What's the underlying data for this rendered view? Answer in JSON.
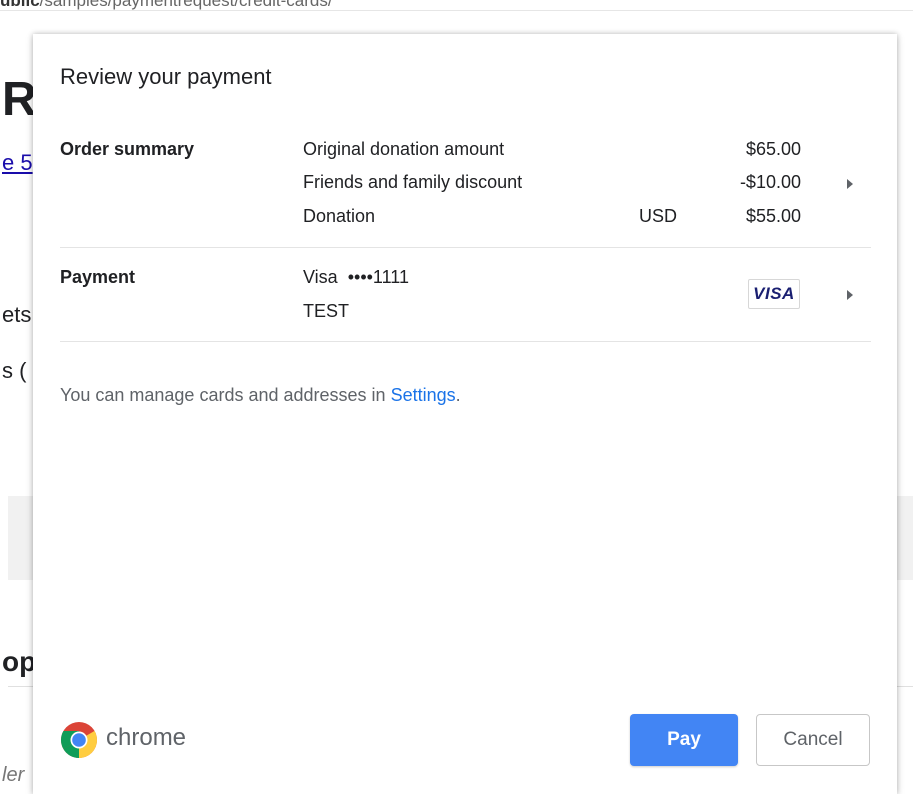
{
  "background_page": {
    "url_bold": "ublic",
    "url_rest": "/samples/paymentrequest/credit-cards/",
    "heading_fragment": "R",
    "link_fragment": "e 5",
    "text_fragment_1": "ets",
    "text_fragment_2": "s (",
    "heading_fragment_2": "op",
    "footer_fragment": "ler"
  },
  "sheet": {
    "title": "Review your payment",
    "order_summary": {
      "label": "Order summary",
      "items": [
        {
          "label": "Original donation amount",
          "currency": "",
          "amount": "$65.00"
        },
        {
          "label": "Friends and family discount",
          "currency": "",
          "amount": "-$10.00"
        },
        {
          "label": "Donation",
          "currency": "USD",
          "amount": "$55.00"
        }
      ]
    },
    "payment": {
      "label": "Payment",
      "card_brand": "Visa",
      "card_mask": "••••1111",
      "cardholder": "TEST",
      "badge": "VISA"
    },
    "manage_text": "You can manage cards and addresses in ",
    "settings_link": "Settings",
    "manage_suffix": ".",
    "footer": {
      "brand": "chrome",
      "pay_label": "Pay",
      "cancel_label": "Cancel"
    }
  },
  "colors": {
    "pay_button": "#4285f4",
    "link": "#1a73e8",
    "visa_blue": "#1a1f71"
  },
  "icons": [
    "chevron-right-icon",
    "chrome-logo-icon",
    "visa-logo-icon"
  ]
}
